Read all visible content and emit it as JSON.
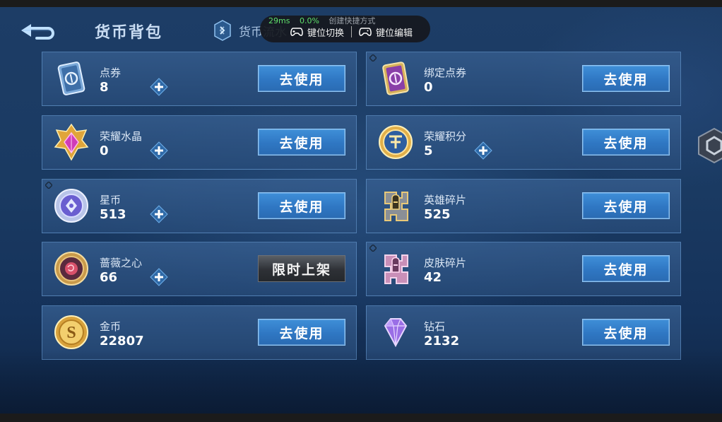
{
  "overlay": {
    "ping": "29ms",
    "loss": "0.0%",
    "hint": "创建快捷方式",
    "key_switch": "键位切换",
    "key_edit": "键位编辑"
  },
  "header": {
    "title": "货币背包",
    "ledger_label": "货币流水"
  },
  "colors": {
    "use_button": "#3f8fd8",
    "card_border": "#6ea0d7",
    "limited_button": "#2e3136"
  },
  "currencies": [
    {
      "name": "点券",
      "value": "8",
      "icon": "voucher-card-icon",
      "plus": true,
      "action": "去使用"
    },
    {
      "name": "绑定点券",
      "value": "0",
      "icon": "bound-voucher-card-icon",
      "plus": false,
      "action": "去使用"
    },
    {
      "name": "荣耀水晶",
      "value": "0",
      "icon": "glory-crystal-icon",
      "plus": true,
      "action": "去使用"
    },
    {
      "name": "荣耀积分",
      "value": "5",
      "icon": "glory-points-coin-icon",
      "plus": true,
      "action": "去使用"
    },
    {
      "name": "星币",
      "value": "513",
      "icon": "star-coin-icon",
      "plus": true,
      "action": "去使用"
    },
    {
      "name": "英雄碎片",
      "value": "525",
      "icon": "hero-fragment-icon",
      "plus": false,
      "action": "去使用"
    },
    {
      "name": "蔷薇之心",
      "value": "66",
      "icon": "rose-heart-icon",
      "plus": true,
      "action": "限时上架"
    },
    {
      "name": "皮肤碎片",
      "value": "42",
      "icon": "skin-fragment-icon",
      "plus": false,
      "action": "去使用"
    },
    {
      "name": "金币",
      "value": "22807",
      "icon": "gold-coin-icon",
      "plus": false,
      "action": "去使用"
    },
    {
      "name": "钻石",
      "value": "2132",
      "icon": "diamond-icon",
      "plus": false,
      "action": "去使用"
    }
  ]
}
